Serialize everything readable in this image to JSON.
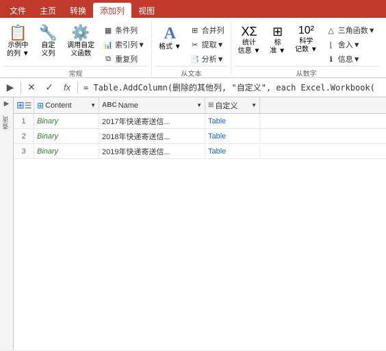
{
  "tabs": [
    {
      "label": "文件",
      "active": false
    },
    {
      "label": "主页",
      "active": false
    },
    {
      "label": "转换",
      "active": false
    },
    {
      "label": "添加列",
      "active": true
    },
    {
      "label": "视图",
      "active": false
    }
  ],
  "ribbon": {
    "groups": [
      {
        "name": "常规",
        "label": "常规",
        "buttons": [
          {
            "label": "示例中\n的列▼",
            "icon": "📋",
            "type": "large"
          },
          {
            "label": "自定\n义列",
            "icon": "🔧",
            "type": "large"
          },
          {
            "label": "调用自定\n义函数",
            "icon": "⚙️",
            "type": "large"
          }
        ],
        "smallButtons": [
          {
            "label": "条件列"
          },
          {
            "label": "索引列▼"
          },
          {
            "label": "重复列"
          }
        ]
      },
      {
        "name": "从文本",
        "label": "从文本",
        "buttons": [
          {
            "label": "格式▼",
            "icon": "A",
            "type": "large"
          }
        ],
        "smallButtons": [
          {
            "label": "合并列"
          },
          {
            "label": "提取▼"
          },
          {
            "label": "分析▼"
          }
        ]
      },
      {
        "name": "从数字",
        "label": "从数字",
        "buttons": [
          {
            "label": "统计\n信息▼",
            "icon": "Σ",
            "type": "large"
          },
          {
            "label": "标\n准▼",
            "icon": "±",
            "type": "large"
          },
          {
            "label": "科学\n记数▼",
            "icon": "10²",
            "type": "large"
          }
        ],
        "smallButtons": [
          {
            "label": "三角函数▼"
          },
          {
            "label": "舍入▼"
          },
          {
            "label": "信息▼"
          }
        ]
      }
    ]
  },
  "formula_bar": {
    "formula": "= Table.AddColumn(删除的其他列, \"自定义\", each Excel.Workbook("
  },
  "sidebar": {
    "arrow": "▶",
    "label": "查询"
  },
  "table": {
    "headers": [
      {
        "label": "",
        "icon": "☰",
        "type": "check"
      },
      {
        "label": "Content",
        "icon": "⊞",
        "hasArrow": true
      },
      {
        "label": "Name",
        "icon": "ABC",
        "hasArrow": true
      },
      {
        "label": "自定义",
        "icon": "🔧",
        "hasArrow": true
      }
    ],
    "rows": [
      {
        "num": "1",
        "binary": "Binary",
        "name": "2017年快递寄送信...",
        "table": "Table"
      },
      {
        "num": "2",
        "binary": "Binary",
        "name": "2018年快递寄送信...",
        "table": "Table"
      },
      {
        "num": "3",
        "binary": "Binary",
        "name": "2019年快递寄送信...",
        "table": "Table"
      }
    ]
  }
}
